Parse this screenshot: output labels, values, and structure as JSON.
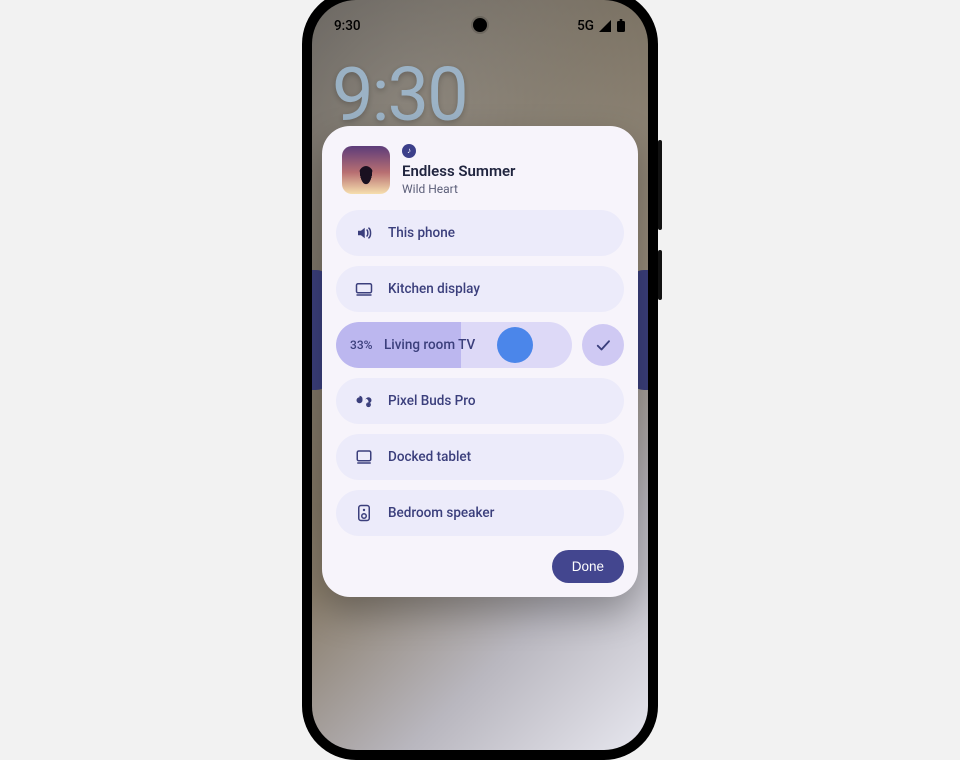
{
  "status": {
    "time": "9:30",
    "network": "5G"
  },
  "lockscreen": {
    "clock": "9:30"
  },
  "cast": {
    "app_icon": "spotify-icon",
    "track": "Endless Summer",
    "artist": "Wild Heart",
    "devices": [
      {
        "icon": "volume-icon",
        "label": "This phone"
      },
      {
        "icon": "display-icon",
        "label": "Kitchen display"
      },
      {
        "icon": "tv-icon",
        "label": "Living room TV",
        "active": true,
        "volume_pct": 33,
        "volume_label": "33%"
      },
      {
        "icon": "earbuds-icon",
        "label": "Pixel Buds Pro"
      },
      {
        "icon": "tablet-icon",
        "label": "Docked tablet"
      },
      {
        "icon": "speaker-icon",
        "label": "Bedroom speaker"
      }
    ],
    "done_label": "Done"
  },
  "colors": {
    "accent": "#43468f",
    "row_bg": "#ecebfa",
    "active_fill": "#bcb7ef",
    "thumb": "#4b86ea"
  }
}
